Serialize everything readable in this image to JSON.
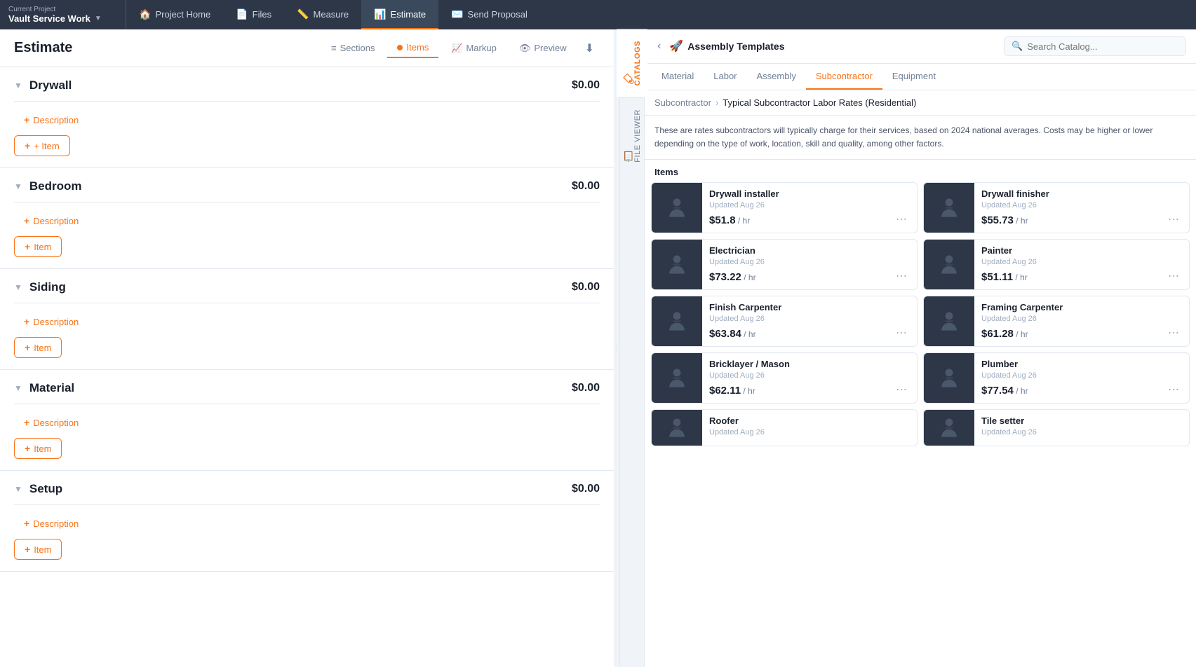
{
  "topNav": {
    "currentProjectLabel": "Current Project",
    "projectName": "Vault Service Work",
    "tabs": [
      {
        "id": "project-home",
        "label": "Project Home",
        "icon": "🏠",
        "active": false
      },
      {
        "id": "files",
        "label": "Files",
        "icon": "📄",
        "active": false
      },
      {
        "id": "measure",
        "label": "Measure",
        "icon": "📏",
        "active": false
      },
      {
        "id": "estimate",
        "label": "Estimate",
        "icon": "📊",
        "active": true
      },
      {
        "id": "send-proposal",
        "label": "Send Proposal",
        "icon": "✉️",
        "active": false
      }
    ]
  },
  "estimate": {
    "title": "Estimate",
    "tabs": [
      {
        "id": "sections",
        "label": "Sections",
        "icon": "≡",
        "active": false
      },
      {
        "id": "items",
        "label": "Items",
        "icon": "dot",
        "active": true
      },
      {
        "id": "markup",
        "label": "Markup",
        "icon": "📈",
        "active": false
      },
      {
        "id": "preview",
        "label": "Preview",
        "icon": "👁",
        "active": false
      }
    ],
    "sections": [
      {
        "id": "drywall",
        "name": "Drywall",
        "amount": "$0.00"
      },
      {
        "id": "bedroom",
        "name": "Bedroom",
        "amount": "$0.00"
      },
      {
        "id": "siding",
        "name": "Siding",
        "amount": "$0.00"
      },
      {
        "id": "material",
        "name": "Material",
        "amount": "$0.00"
      },
      {
        "id": "setup",
        "name": "Setup",
        "amount": "$0.00"
      }
    ],
    "addDescriptionLabel": "+ Description",
    "addItemLabel": "+ Item"
  },
  "catalog": {
    "backBtn": "‹",
    "assemblyTitle": "Assembly Templates",
    "searchPlaceholder": "Search Catalog...",
    "typeTabs": [
      {
        "id": "material",
        "label": "Material",
        "active": false
      },
      {
        "id": "labor",
        "label": "Labor",
        "active": false
      },
      {
        "id": "assembly",
        "label": "Assembly",
        "active": false
      },
      {
        "id": "subcontractor",
        "label": "Subcontractor",
        "active": true
      },
      {
        "id": "equipment",
        "label": "Equipment",
        "active": false
      }
    ],
    "breadcrumb": {
      "parent": "Subcontractor",
      "current": "Typical Subcontractor Labor Rates (Residential)"
    },
    "description": "These are rates subcontractors will typically charge for their services, based on 2024 national averages. Costs may be higher or lower depending on the type of work, location, skill and quality, among other factors.",
    "itemsLabel": "Items",
    "items": [
      {
        "id": "drywall-installer",
        "name": "Drywall installer",
        "updated": "Updated Aug 26",
        "price": "$51.8",
        "unit": "/ hr"
      },
      {
        "id": "drywall-finisher",
        "name": "Drywall finisher",
        "updated": "Updated Aug 26",
        "price": "$55.73",
        "unit": "/ hr"
      },
      {
        "id": "electrician",
        "name": "Electrician",
        "updated": "Updated Aug 26",
        "price": "$73.22",
        "unit": "/ hr"
      },
      {
        "id": "painter",
        "name": "Painter",
        "updated": "Updated Aug 26",
        "price": "$51.11",
        "unit": "/ hr"
      },
      {
        "id": "finish-carpenter",
        "name": "Finish Carpenter",
        "updated": "Updated Aug 26",
        "price": "$63.84",
        "unit": "/ hr"
      },
      {
        "id": "framing-carpenter",
        "name": "Framing Carpenter",
        "updated": "Updated Aug 26",
        "price": "$61.28",
        "unit": "/ hr"
      },
      {
        "id": "bricklayer-mason",
        "name": "Bricklayer / Mason",
        "updated": "Updated Aug 26",
        "price": "$62.11",
        "unit": "/ hr"
      },
      {
        "id": "plumber",
        "name": "Plumber",
        "updated": "Updated Aug 26",
        "price": "$77.54",
        "unit": "/ hr"
      },
      {
        "id": "roofer",
        "name": "Roofer",
        "updated": "Updated Aug 26",
        "price": "",
        "unit": ""
      },
      {
        "id": "tile-setter",
        "name": "Tile setter",
        "updated": "Updated Aug 26",
        "price": "",
        "unit": ""
      }
    ],
    "verticalTabs": [
      {
        "id": "catalogs",
        "label": "CATALOGS",
        "active": true
      },
      {
        "id": "file-viewer",
        "label": "FILE VIEWER",
        "active": false
      }
    ]
  }
}
